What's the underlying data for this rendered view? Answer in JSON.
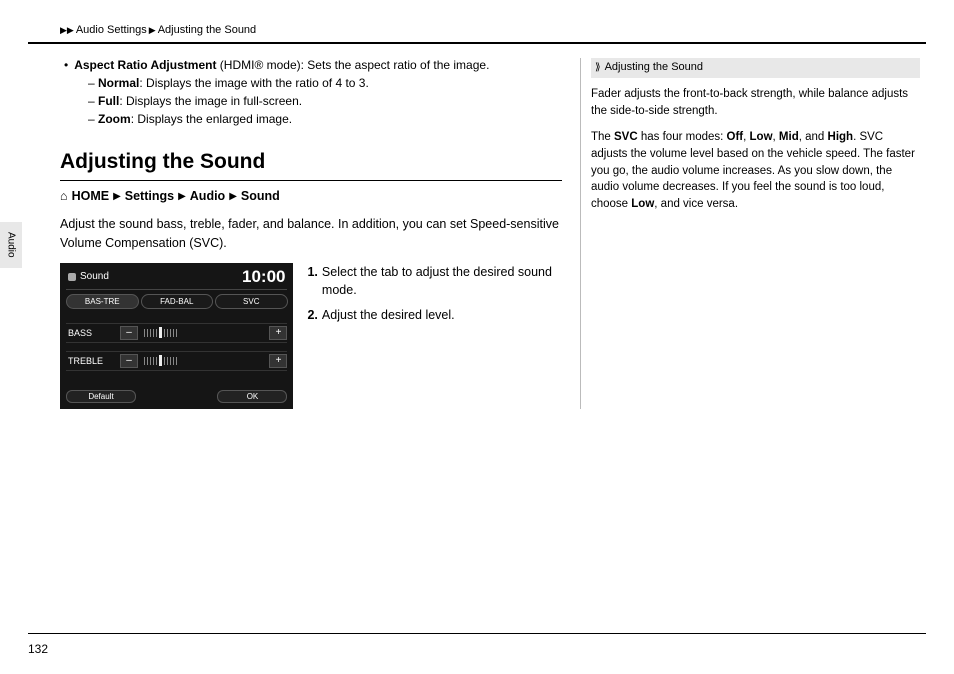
{
  "header": {
    "crumb1": "Audio Settings",
    "crumb2": "Adjusting the Sound"
  },
  "sideTab": "Audio",
  "bullets": {
    "aspect": {
      "title": "Aspect Ratio Adjustment",
      "suffix": " (HDMI® mode): Sets the aspect ratio of the image."
    },
    "normal": {
      "title": "Normal",
      "text": ": Displays the image with the ratio of 4 to 3."
    },
    "full": {
      "title": "Full",
      "text": ": Displays the image in full-screen."
    },
    "zoom": {
      "title": "Zoom",
      "text": ": Displays the enlarged image."
    }
  },
  "section": {
    "heading": "Adjusting the Sound",
    "path": {
      "home": "HOME",
      "settings": "Settings",
      "audio": "Audio",
      "sound": "Sound"
    },
    "intro": "Adjust the sound bass, treble, fader, and balance. In addition, you can set Speed-sensitive Volume Compensation (SVC).",
    "steps": {
      "s1": "Select the tab to adjust the desired sound mode.",
      "s2": "Adjust the desired level."
    }
  },
  "device": {
    "title": "Sound",
    "clock": "10:00",
    "tabs": {
      "t1": "BAS-TRE",
      "t2": "FAD-BAL",
      "t3": "SVC"
    },
    "rows": {
      "bass": "BASS",
      "treble": "TREBLE"
    },
    "minus": "–",
    "plus": "+",
    "bottom": {
      "default": "Default",
      "ok": "OK"
    }
  },
  "sidebar": {
    "title": "Adjusting the Sound",
    "p1": "Fader adjusts the front-to-back strength, while balance adjusts the side-to-side strength.",
    "p2a": "The ",
    "p2b": " has four modes: ",
    "svc": "SVC",
    "off": "Off",
    "low": "Low",
    "mid": "Mid",
    "high": "High",
    "comma": ", ",
    "and": ", and ",
    "period": ". ",
    "p2c": "SVC adjusts the volume level based on the vehicle speed. The faster you go, the audio volume increases. As you slow down, the audio volume decreases. If you feel the sound is too loud, choose ",
    "p2d": ", and vice versa."
  },
  "pageNumber": "132"
}
